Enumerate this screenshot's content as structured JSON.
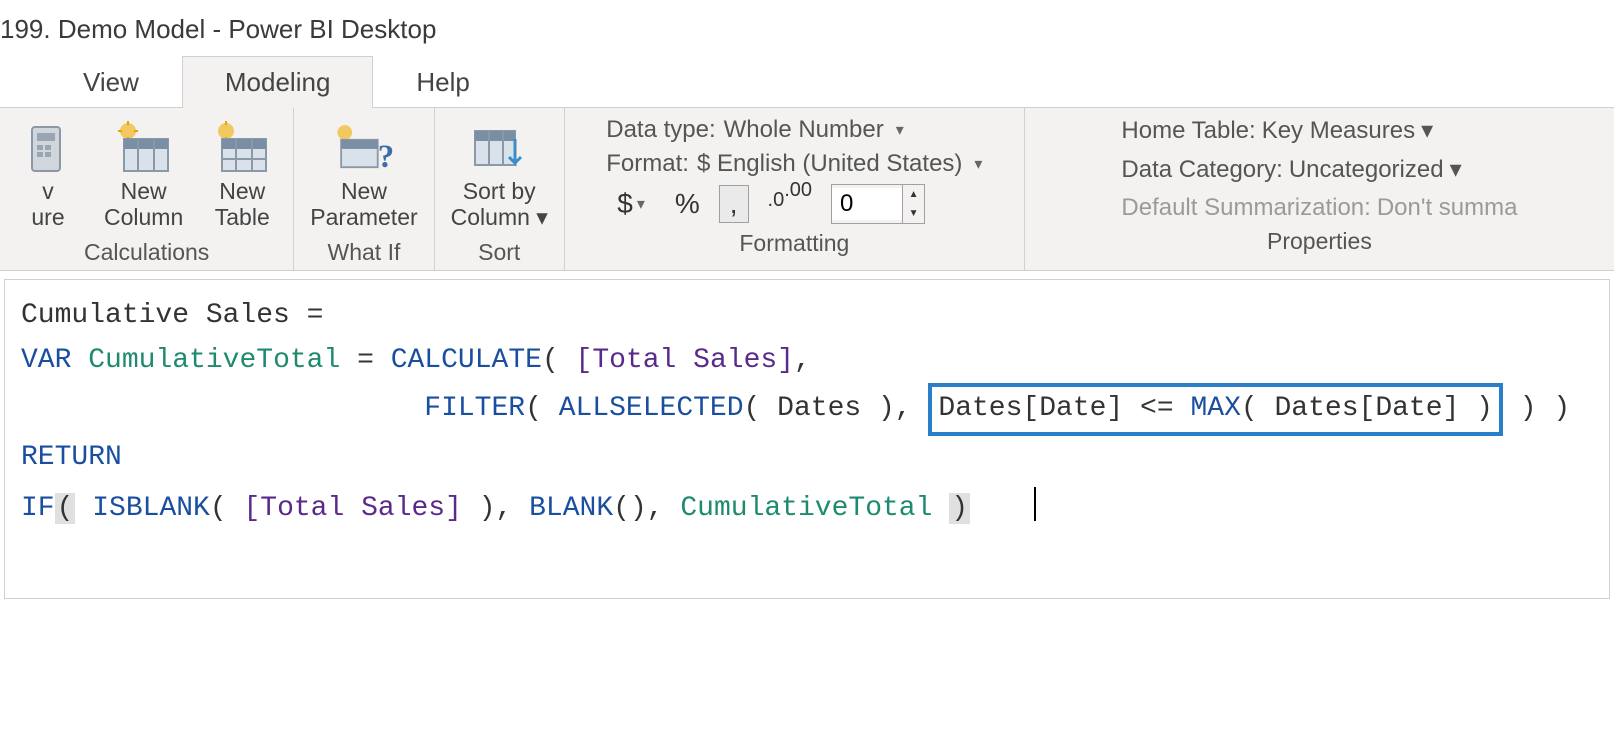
{
  "title": "199. Demo Model - Power BI Desktop",
  "tabs": {
    "view": "View",
    "modeling": "Modeling",
    "help": "Help"
  },
  "ribbon": {
    "calc": {
      "newMeasure": "v\nure",
      "newColumn": "New\nColumn",
      "newTable": "New\nTable",
      "groupLabel": "Calculations"
    },
    "whatif": {
      "newParameter": "New\nParameter",
      "groupLabel": "What If"
    },
    "sort": {
      "sortBy": "Sort by\nColumn",
      "groupLabel": "Sort"
    },
    "formatting": {
      "dataTypeLabel": "Data type:",
      "dataTypeValue": "Whole Number",
      "formatLabel": "Format:",
      "formatValue": "$ English (United States)",
      "currency": "$",
      "percent": "%",
      "thousands": ",",
      "decimals": ".00",
      "decimalPlaces": "0",
      "groupLabel": "Formatting"
    },
    "properties": {
      "homeTableLabel": "Home Table:",
      "homeTableValue": "Key Measures",
      "dataCategoryLabel": "Data Category:",
      "dataCategoryValue": "Uncategorized",
      "defaultSummLabel": "Default Summarization:",
      "defaultSummValue": "Don't summa",
      "groupLabel": "Properties"
    }
  },
  "formula": {
    "line1_name": "Cumulative Sales",
    "eq": " = ",
    "var": "VAR",
    "varName": "CumulativeTotal",
    "calc": "CALCULATE",
    "totalSales": "[Total Sales]",
    "filter": "FILTER",
    "allselected": "ALLSELECTED",
    "datesTbl": "Dates",
    "datesCol": "Dates[Date]",
    "lte": "<=",
    "max": "MAX",
    "return": "RETURN",
    "if": "IF",
    "isblank": "ISBLANK",
    "blank": "BLANK"
  }
}
